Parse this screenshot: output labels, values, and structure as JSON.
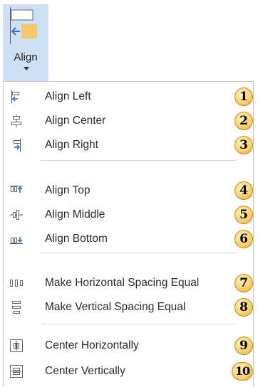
{
  "ribbon": {
    "button_label": "Align",
    "icon_name": "align-left-icon"
  },
  "colors": {
    "ribbon_highlight": "#cde0f5",
    "icon_blue": "#2e75c9",
    "icon_gold": "#f4c76b",
    "badge_fill": "#fbd36e",
    "badge_border": "#c98a1f"
  },
  "menu": {
    "items": [
      {
        "label": "Align Left",
        "icon": "align-left-icon",
        "badge": "1"
      },
      {
        "label": "Align Center",
        "icon": "align-center-icon",
        "badge": "2"
      },
      {
        "label": "Align Right",
        "icon": "align-right-icon",
        "badge": "3"
      },
      {
        "label": "Align Top",
        "icon": "align-top-icon",
        "badge": "4"
      },
      {
        "label": "Align Middle",
        "icon": "align-middle-icon",
        "badge": "5"
      },
      {
        "label": "Align Bottom",
        "icon": "align-bottom-icon",
        "badge": "6"
      },
      {
        "label": "Make Horizontal Spacing Equal",
        "icon": "horizontal-spacing-icon",
        "badge": "7"
      },
      {
        "label": "Make Vertical Spacing Equal",
        "icon": "vertical-spacing-icon",
        "badge": "8"
      },
      {
        "label": "Center Horizontally",
        "icon": "center-horizontally-icon",
        "badge": "9"
      },
      {
        "label": "Center Vertically",
        "icon": "center-vertically-icon",
        "badge": "10"
      }
    ]
  }
}
